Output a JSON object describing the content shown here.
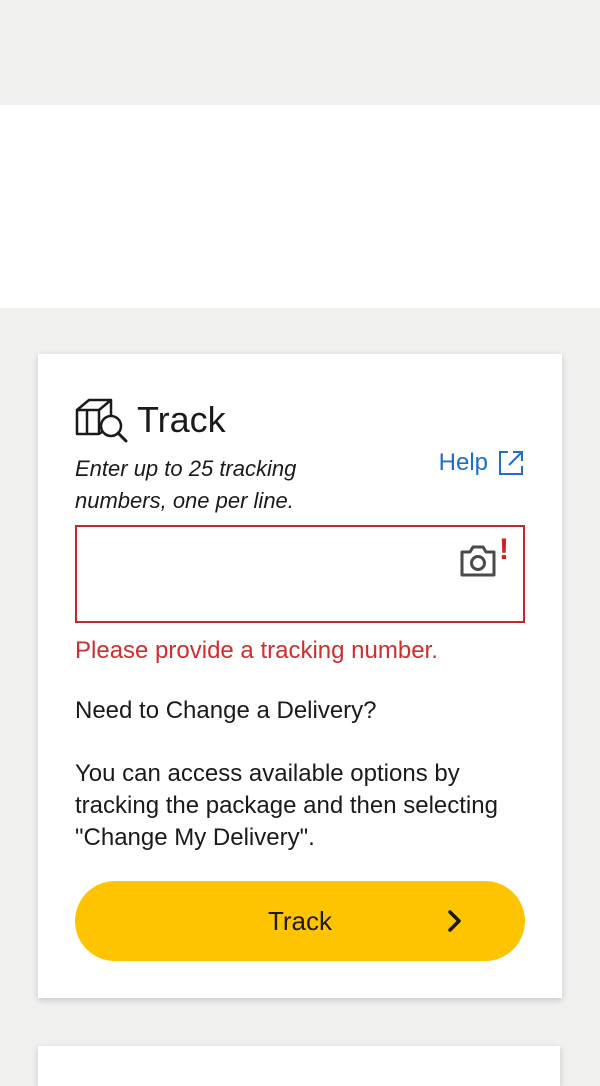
{
  "track_card": {
    "title": "Track",
    "instructions": "Enter up to 25 tracking numbers, one per line.",
    "help_label": "Help",
    "tracking_input": {
      "value": "",
      "placeholder": ""
    },
    "error_message": "Please provide a tracking number.",
    "change_heading": "Need to Change a Delivery?",
    "change_body": "You can access available options by tracking the package and then selecting \"Change My Delivery\".",
    "track_button_label": "Track"
  },
  "icons": {
    "title_icon": "package-search-icon",
    "help_icon": "external-link-icon",
    "camera_icon": "camera-icon",
    "error_icon": "exclamation-icon",
    "button_icon": "chevron-right-icon"
  },
  "colors": {
    "accent_yellow": "#ffc400",
    "error_red": "#d22d2d",
    "link_blue": "#1f6fc7",
    "page_bg": "#f0f0ef"
  }
}
